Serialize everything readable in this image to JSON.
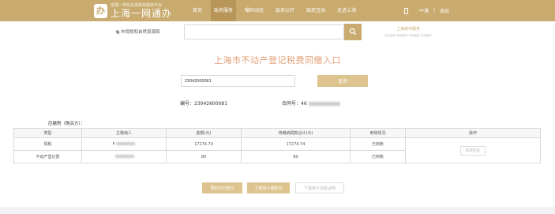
{
  "header": {
    "logo_char": "办",
    "logo_subtitle": "全国一体化在线政务服务平台",
    "logo_title": "上海一网通办",
    "nav": [
      "首页",
      "政务服务",
      "曝码动态",
      "政务公开",
      "政民互动",
      "走进上海"
    ],
    "active_nav": 1,
    "user_name": "**港",
    "logout": "退出"
  },
  "search": {
    "region": "市规划和自然资源局",
    "placeholder": "",
    "brand_title": "上海城市服务",
    "brand_links": "民生服务  政务服务  市场服务  文化服务"
  },
  "page_title": "上海市不动产登记税费同缴入口",
  "query": {
    "value": "23042600081",
    "button": "查询"
  },
  "info": {
    "code_label": "编号：",
    "code_value": "23042600081",
    "contract_label": "合同号：",
    "contract_value": "46"
  },
  "section_label": "应缴税（购买方）：",
  "table": {
    "headers": [
      "类型",
      "主缴纳人",
      "金额(元)",
      "待缴纳税款合计(元)",
      "到账情况",
      "操作"
    ],
    "rows": [
      {
        "type": "契税",
        "payer": "F",
        "amount": "17274.74",
        "total": "17274.74",
        "status": "已到账"
      },
      {
        "type": "不动产登记费",
        "payer": "",
        "amount": "80",
        "total": "80",
        "status": "已到账"
      }
    ],
    "action_label": "税票回查"
  },
  "buttons": {
    "a": "预约交付登记",
    "b": "下载电子缴款书",
    "c": "下载电子完税证明"
  },
  "colors": {
    "brand": "#c9ab6f",
    "title": "#e3a17a",
    "status": "#31a05f"
  }
}
